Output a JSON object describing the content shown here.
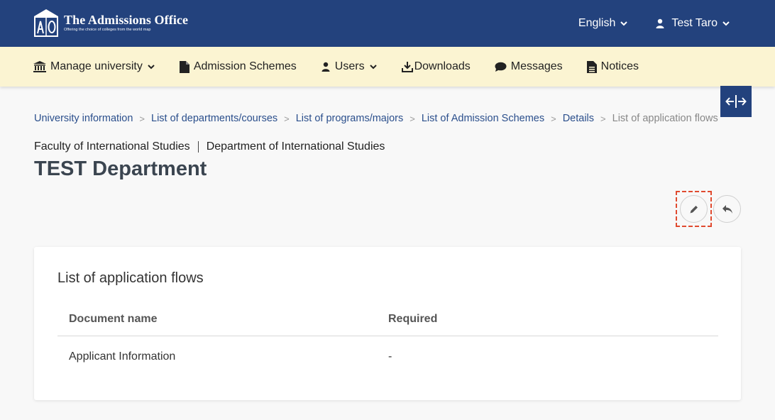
{
  "header": {
    "logo_letters": "AO",
    "title": "The Admissions Office",
    "tagline": "Offering the choice of colleges from the world map",
    "language": "English",
    "user": "Test Taro"
  },
  "nav": {
    "items": [
      {
        "label": "Manage university",
        "icon": "bank-icon"
      },
      {
        "label": "Admission Schemes",
        "icon": "file-icon"
      },
      {
        "label": "Users",
        "icon": "user-icon"
      },
      {
        "label": "Downloads",
        "icon": "download-icon"
      },
      {
        "label": "Messages",
        "icon": "chat-icon"
      },
      {
        "label": "Notices",
        "icon": "document-icon"
      }
    ]
  },
  "breadcrumb": {
    "items": [
      "University information",
      "List of departments/courses",
      "List of programs/majors",
      "List of Admission Schemes",
      "Details",
      "List of application flows"
    ],
    "separator": ">"
  },
  "page": {
    "faculty": "Faculty of International Studies",
    "department": "Department of International Studies",
    "title": "TEST Department"
  },
  "card": {
    "title": "List of application flows",
    "columns": [
      "Document name",
      "Required"
    ],
    "rows": [
      [
        "Applicant Information",
        "-"
      ]
    ]
  },
  "colors": {
    "header_bg": "#23427d",
    "nav_bg": "#fbf4d2",
    "focus_outline": "#e04a2f",
    "link": "#2b4f8c"
  }
}
